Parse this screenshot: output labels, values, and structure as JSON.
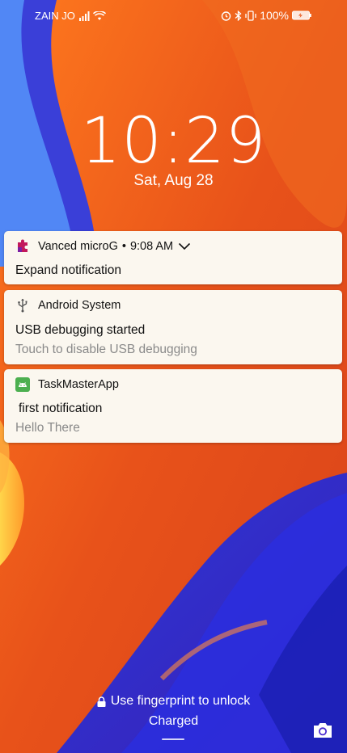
{
  "status_bar": {
    "carrier": "ZAIN JO",
    "battery_text": "100%",
    "icons": [
      "signal-icon",
      "wifi-icon",
      "alarm-icon",
      "bluetooth-icon",
      "vibrate-icon",
      "battery-icon"
    ]
  },
  "lockscreen": {
    "time": "10:29",
    "date": "Sat, Aug 28",
    "unlock_hint": "Use fingerprint to unlock",
    "charge_status": "Charged"
  },
  "notifications": [
    {
      "app": "Vanced microG",
      "time": "9:08 AM",
      "title": "Expand notification",
      "body": "",
      "icon": "puzzle-icon",
      "icon_color": "#c2185b"
    },
    {
      "app": "Android System",
      "time": "",
      "title": "USB debugging started",
      "body": "Touch to disable USB debugging",
      "icon": "usb-icon",
      "icon_color": "#555555"
    },
    {
      "app": "TaskMasterApp",
      "time": "",
      "title": "first notification",
      "body": "Hello There",
      "icon": "android-icon",
      "icon_color": "#4caf50"
    }
  ]
}
